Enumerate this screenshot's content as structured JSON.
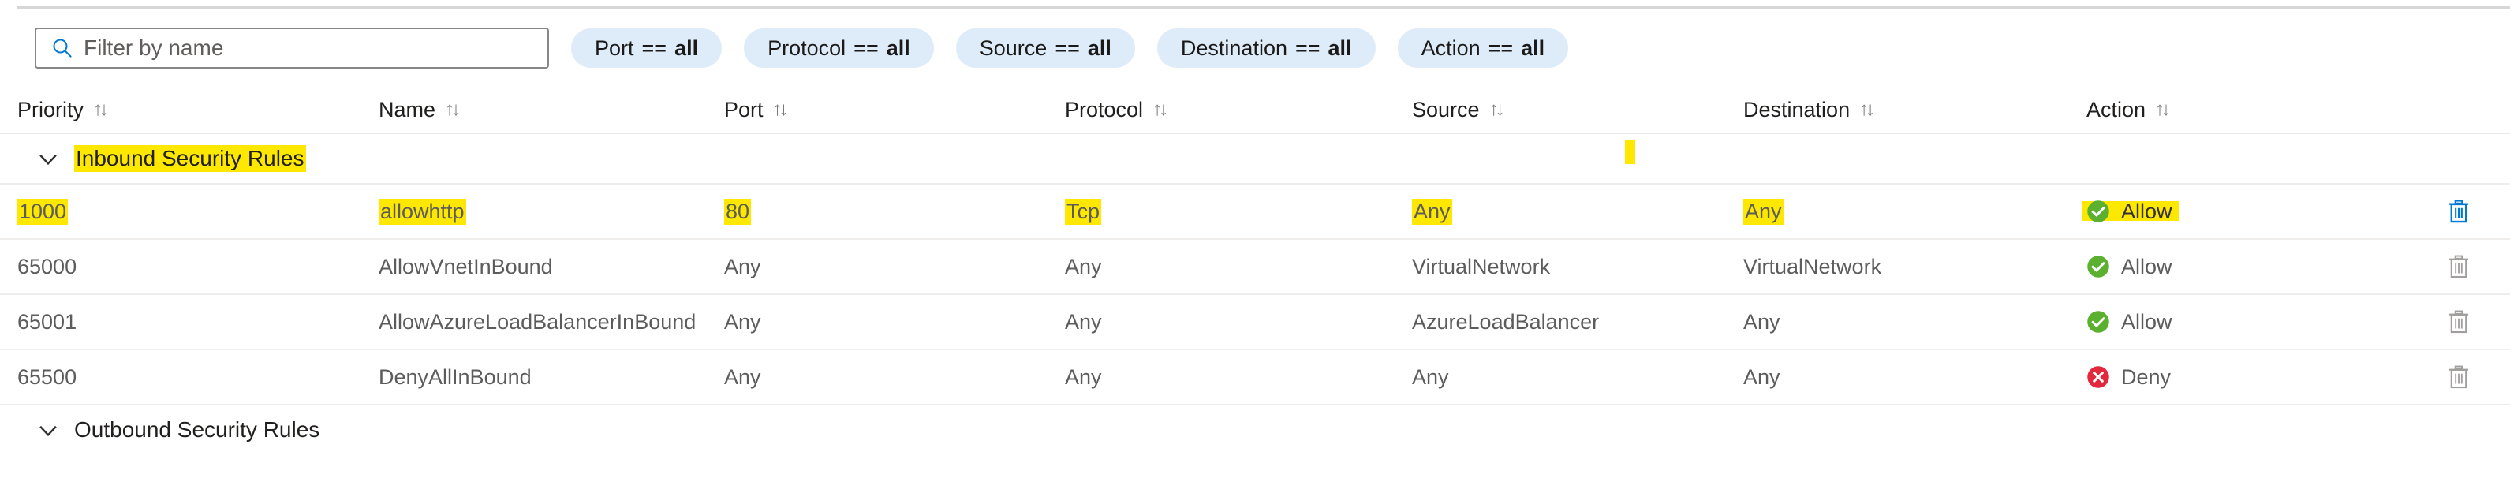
{
  "search": {
    "placeholder": "Filter by name",
    "value": "",
    "icon": "search-icon"
  },
  "filters": [
    {
      "key": "Port",
      "op": "==",
      "value": "all"
    },
    {
      "key": "Protocol",
      "op": "==",
      "value": "all"
    },
    {
      "key": "Source",
      "op": "==",
      "value": "all"
    },
    {
      "key": "Destination",
      "op": "==",
      "value": "all"
    },
    {
      "key": "Action",
      "op": "==",
      "value": "all"
    }
  ],
  "columns": {
    "priority": "Priority",
    "name": "Name",
    "port": "Port",
    "protocol": "Protocol",
    "source": "Source",
    "destination": "Destination",
    "action": "Action",
    "sort_glyph": "↑↓"
  },
  "groups": {
    "inbound": {
      "label": "Inbound Security Rules",
      "expanded": true,
      "highlighted": true
    },
    "outbound": {
      "label": "Outbound Security Rules",
      "expanded": true,
      "highlighted": false
    }
  },
  "rows": [
    {
      "priority": "1000",
      "name": "allowhttp",
      "port": "80",
      "protocol": "Tcp",
      "source": "Any",
      "destination": "Any",
      "action": "Allow",
      "action_icon": "check-circle-icon",
      "delete_enabled": true,
      "highlighted": true
    },
    {
      "priority": "65000",
      "name": "AllowVnetInBound",
      "port": "Any",
      "protocol": "Any",
      "source": "VirtualNetwork",
      "destination": "VirtualNetwork",
      "action": "Allow",
      "action_icon": "check-circle-icon",
      "delete_enabled": false,
      "highlighted": false
    },
    {
      "priority": "65001",
      "name": "AllowAzureLoadBalancerInBound",
      "port": "Any",
      "protocol": "Any",
      "source": "AzureLoadBalancer",
      "destination": "Any",
      "action": "Allow",
      "action_icon": "check-circle-icon",
      "delete_enabled": false,
      "highlighted": false
    },
    {
      "priority": "65500",
      "name": "DenyAllInBound",
      "port": "Any",
      "protocol": "Any",
      "source": "Any",
      "destination": "Any",
      "action": "Deny",
      "action_icon": "error-circle-icon",
      "delete_enabled": false,
      "highlighted": false
    }
  ],
  "colors": {
    "allow": "#5bb12f",
    "deny": "#e3283e",
    "highlight": "#ffe800",
    "pill_bg": "#deecf9",
    "link": "#0078d4",
    "disabled_icon": "#a19f9d"
  }
}
